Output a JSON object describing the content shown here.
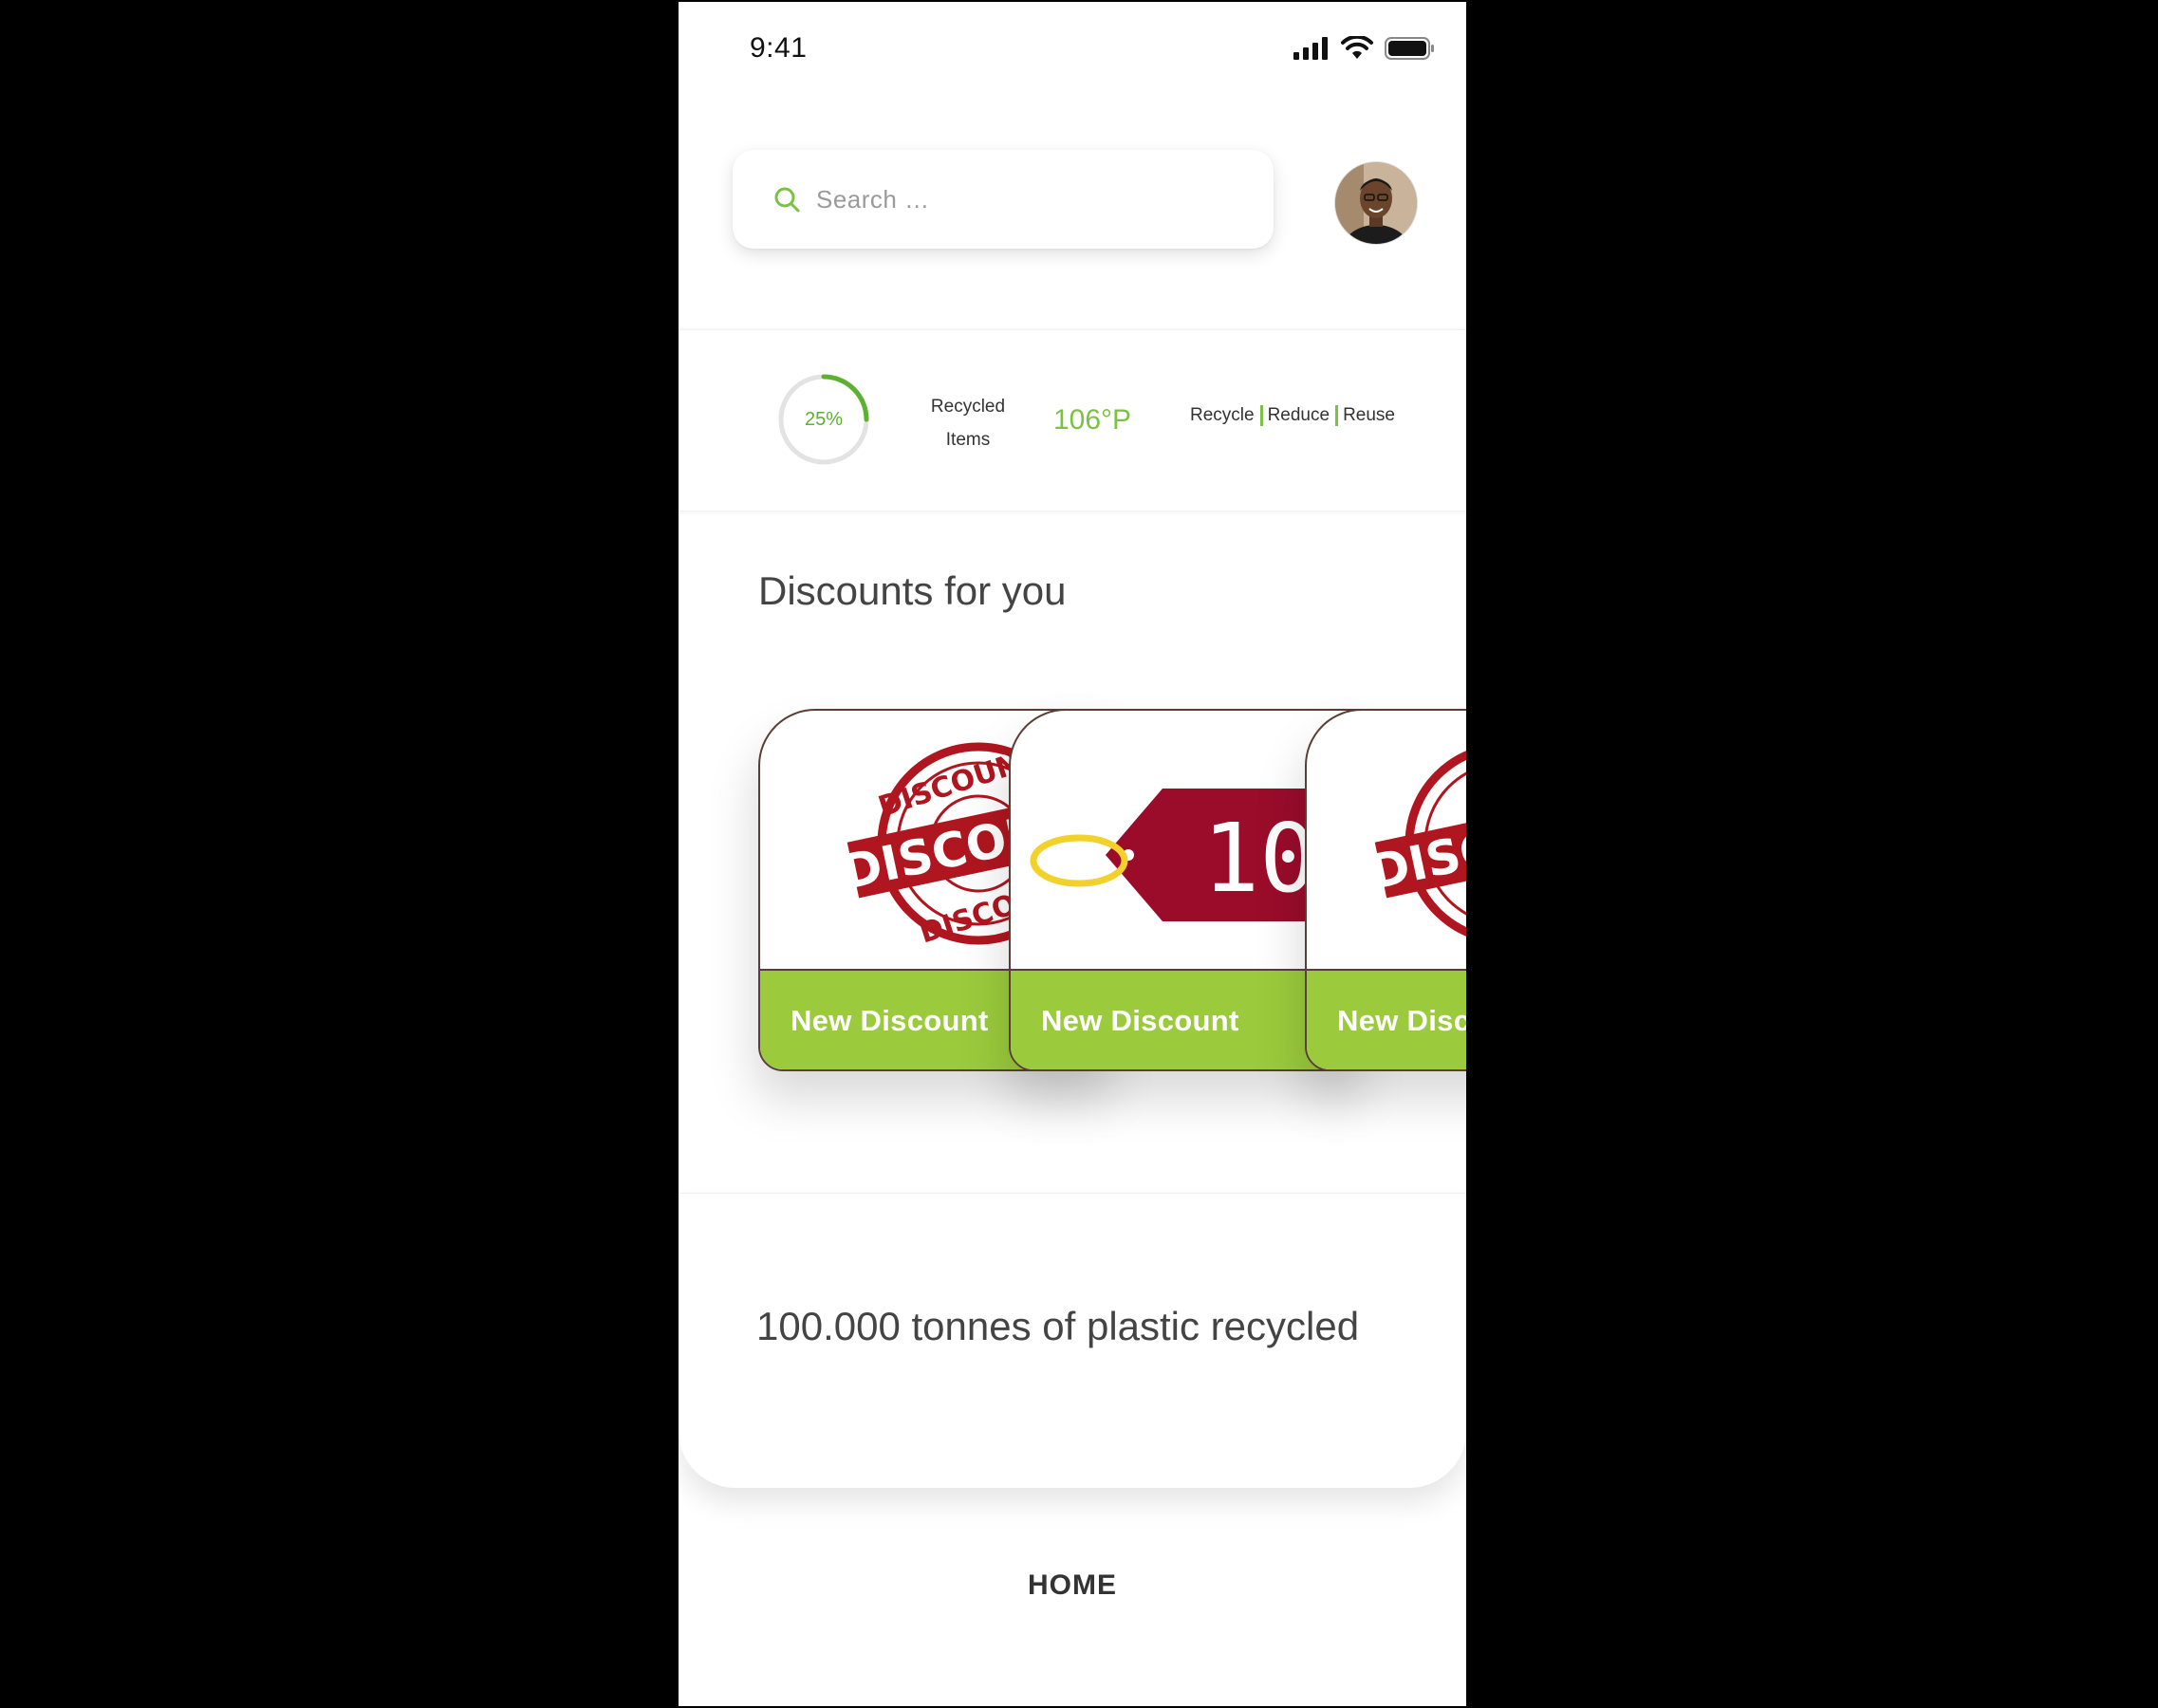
{
  "status_bar": {
    "time": "9:41"
  },
  "search": {
    "placeholder": "Search …"
  },
  "stats": {
    "progress_percent": 25,
    "progress_label": "25%",
    "recycled_label_line1": "Recycled",
    "recycled_label_line2": "Items",
    "points": "106°P",
    "motto": [
      "Recycle",
      "Reduce",
      "Reuse"
    ]
  },
  "discounts": {
    "title": "Discounts for you",
    "cards": [
      {
        "label": "New Discount",
        "stamp_text": "DISCOUNT"
      },
      {
        "label": "New Discount",
        "tag_text": "10"
      },
      {
        "label": "New Discount",
        "stamp_text": "DISCOUNT"
      }
    ]
  },
  "impact": {
    "text": "100.000 tonnes of plastic recycled"
  },
  "nav": {
    "home": "HOME"
  },
  "colors": {
    "accent": "#9bcb3c",
    "accent_text": "#7cc242",
    "stamp_red": "#b0161f",
    "tag_red": "#9a0c2a",
    "tag_loop": "#f2d12a"
  }
}
